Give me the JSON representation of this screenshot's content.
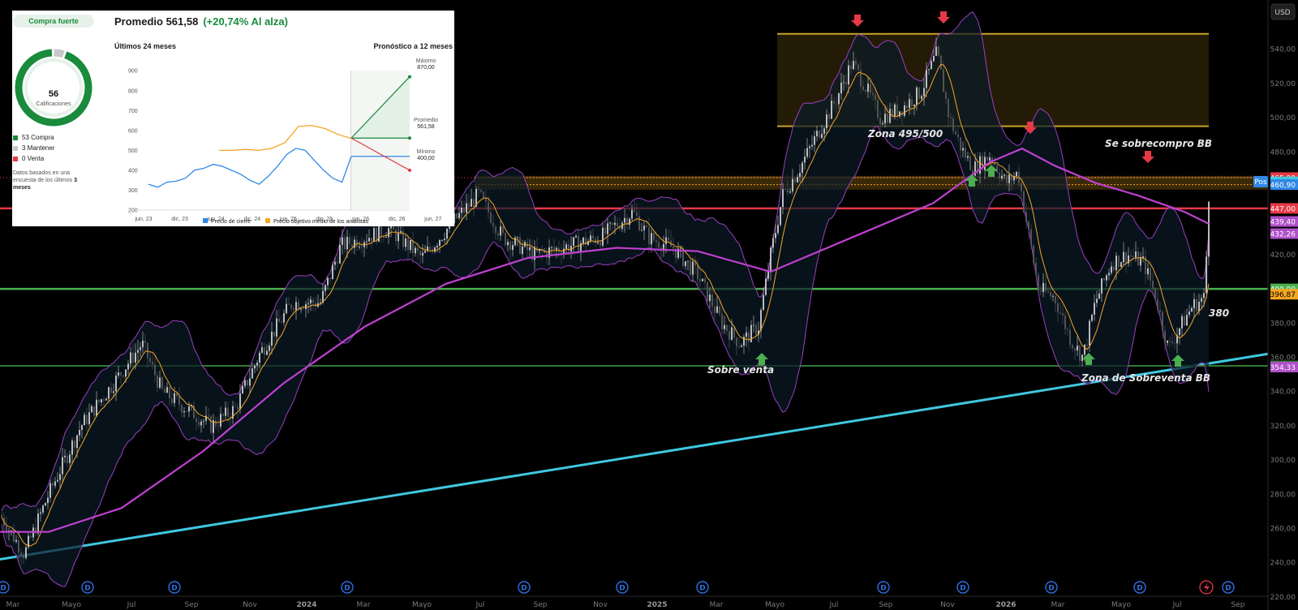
{
  "price_axis": {
    "currency": "USD",
    "ticks": [
      "540,00",
      "520,00",
      "500,00",
      "480,00",
      "440,00",
      "420,00",
      "380,00",
      "360,00",
      "340,00",
      "320,00",
      "300,00",
      "280,00",
      "260,00",
      "240,00",
      "220,00"
    ],
    "tags": [
      {
        "text": "465,00",
        "color": "#e63946",
        "fg": "#ffffff",
        "value": 465
      },
      {
        "text": "464,72",
        "color": "#40c8e0",
        "fg": "#000000",
        "value": 462.5
      },
      {
        "text": "460,90",
        "color": "#2f88e6",
        "fg": "#ffffff",
        "value": 460.9
      },
      {
        "text": "447,00",
        "color": "#e63946",
        "fg": "#ffffff",
        "value": 447
      },
      {
        "text": "439,40",
        "color": "#b050c8",
        "fg": "#ffffff",
        "value": 439.4
      },
      {
        "text": "432,26",
        "color": "#b050c8",
        "fg": "#ffffff",
        "value": 432.26
      },
      {
        "text": "400,00",
        "color": "#4caf50",
        "fg": "#ffffff",
        "value": 400
      },
      {
        "text": "396,87",
        "color": "#f5a623",
        "fg": "#000000",
        "value": 396.87
      },
      {
        "text": "355,00",
        "color": "#2e7d32",
        "fg": "#ffffff",
        "value": 355
      },
      {
        "text": "354,33",
        "color": "#b050c8",
        "fg": "#ffffff",
        "value": 354.33
      }
    ],
    "pos_label": "Pos"
  },
  "time_axis": {
    "labels": [
      {
        "text": "Mar",
        "bold": false
      },
      {
        "text": "Mayo",
        "bold": false
      },
      {
        "text": "Jul",
        "bold": false
      },
      {
        "text": "Sep",
        "bold": false
      },
      {
        "text": "Nov",
        "bold": false
      },
      {
        "text": "2024",
        "bold": true
      },
      {
        "text": "Mar",
        "bold": false
      },
      {
        "text": "Mayo",
        "bold": false
      },
      {
        "text": "Jul",
        "bold": false
      },
      {
        "text": "Sep",
        "bold": false
      },
      {
        "text": "Nov",
        "bold": false
      },
      {
        "text": "2025",
        "bold": true
      },
      {
        "text": "Mar",
        "bold": false
      },
      {
        "text": "Mayo",
        "bold": false
      },
      {
        "text": "Jul",
        "bold": false
      },
      {
        "text": "Sep",
        "bold": false
      },
      {
        "text": "Nov",
        "bold": false
      },
      {
        "text": "2026",
        "bold": true
      },
      {
        "text": "Mar",
        "bold": false
      },
      {
        "text": "Mayo",
        "bold": false
      },
      {
        "text": "Jul",
        "bold": false
      },
      {
        "text": "Sep",
        "bold": false
      }
    ],
    "dividend_marker": "D"
  },
  "chart_data": {
    "type": "line",
    "title": "",
    "ylim": [
      210,
      556
    ],
    "grid": false,
    "levels": [
      {
        "name": "465,00",
        "value": 465,
        "color": "#e63946"
      },
      {
        "name": "447,00",
        "value": 447,
        "color": "#e63946"
      },
      {
        "name": "400,00",
        "value": 400,
        "color": "#4caf50"
      },
      {
        "name": "355,00",
        "value": 355,
        "color": "#2e7d32"
      }
    ],
    "zone": {
      "from": 495,
      "to": 549,
      "color": "#c9a227"
    },
    "annotations": [
      "Zona 495/500",
      "Se sobrecompro BB",
      "Sobre venta",
      "Zona de Sobreventa BB",
      "380"
    ]
  },
  "annotations": {
    "zona": "Zona 495/500",
    "sobrecompro": "Se sobrecompro BB",
    "sobreventa": "Sobre venta",
    "zona_sobreventa": "Zona de Sobreventa BB",
    "level_380": "380"
  },
  "colors": {
    "sma200": "#c040d0",
    "ema": "#f5a623",
    "bollinger": "#9a3fc0",
    "trendline": "#40c8e0",
    "up_arrow": "#4caf50",
    "down_arrow": "#e63946"
  },
  "inset": {
    "rating_badge": "Compra fuerte",
    "title": "Promedio 561,58",
    "title_change": "(+20,74% Al alza)",
    "history_label": "Últimos 24 meses",
    "forecast_label": "Pronóstico a 12 meses",
    "ratings_count": "56",
    "ratings_word": "Calificaciones",
    "legend": [
      {
        "label": "53 Compra",
        "color": "#1a8a3c"
      },
      {
        "label": "3 Mantener",
        "color": "#c8c8c8"
      },
      {
        "label": "0 Venta",
        "color": "#e63946"
      }
    ],
    "note_prefix": "Datos basados en una encuesta de los últimos",
    "note_bold": "3 meses",
    "chart_data": {
      "type": "line",
      "ylim": [
        200,
        900
      ],
      "y_ticks": [
        "900",
        "800",
        "700",
        "600",
        "500",
        "400",
        "300",
        "200"
      ],
      "x_ticks": [
        "jun, 23",
        "dic, 23",
        "jun, 24",
        "dic, 24",
        "jun, 25",
        "dic, 25",
        "jun, 26",
        "dic, 26",
        "jun, 27"
      ],
      "series": [
        {
          "name": "Precio de cierre",
          "color": "#2f88e6",
          "values": [
            330,
            315,
            340,
            345,
            360,
            400,
            410,
            430,
            420,
            400,
            380,
            350,
            330,
            370,
            420,
            480,
            510,
            500,
            450,
            400,
            360,
            340,
            470
          ]
        },
        {
          "name": "Precio objetivo medio de los analistas",
          "color": "#f5a623",
          "values": [
            500,
            500,
            505,
            500,
            510,
            540,
            620,
            625,
            610,
            580,
            560
          ]
        }
      ],
      "forecast": {
        "start": 561.58,
        "max_label": "Máximo",
        "max": "870,00",
        "avg_label": "Promedio",
        "avg": "561,58",
        "min_label": "Mínimo",
        "min": "400,00"
      },
      "legend": [
        "Precio de cierre",
        "Precio objetivo medio de los analistas"
      ]
    }
  }
}
